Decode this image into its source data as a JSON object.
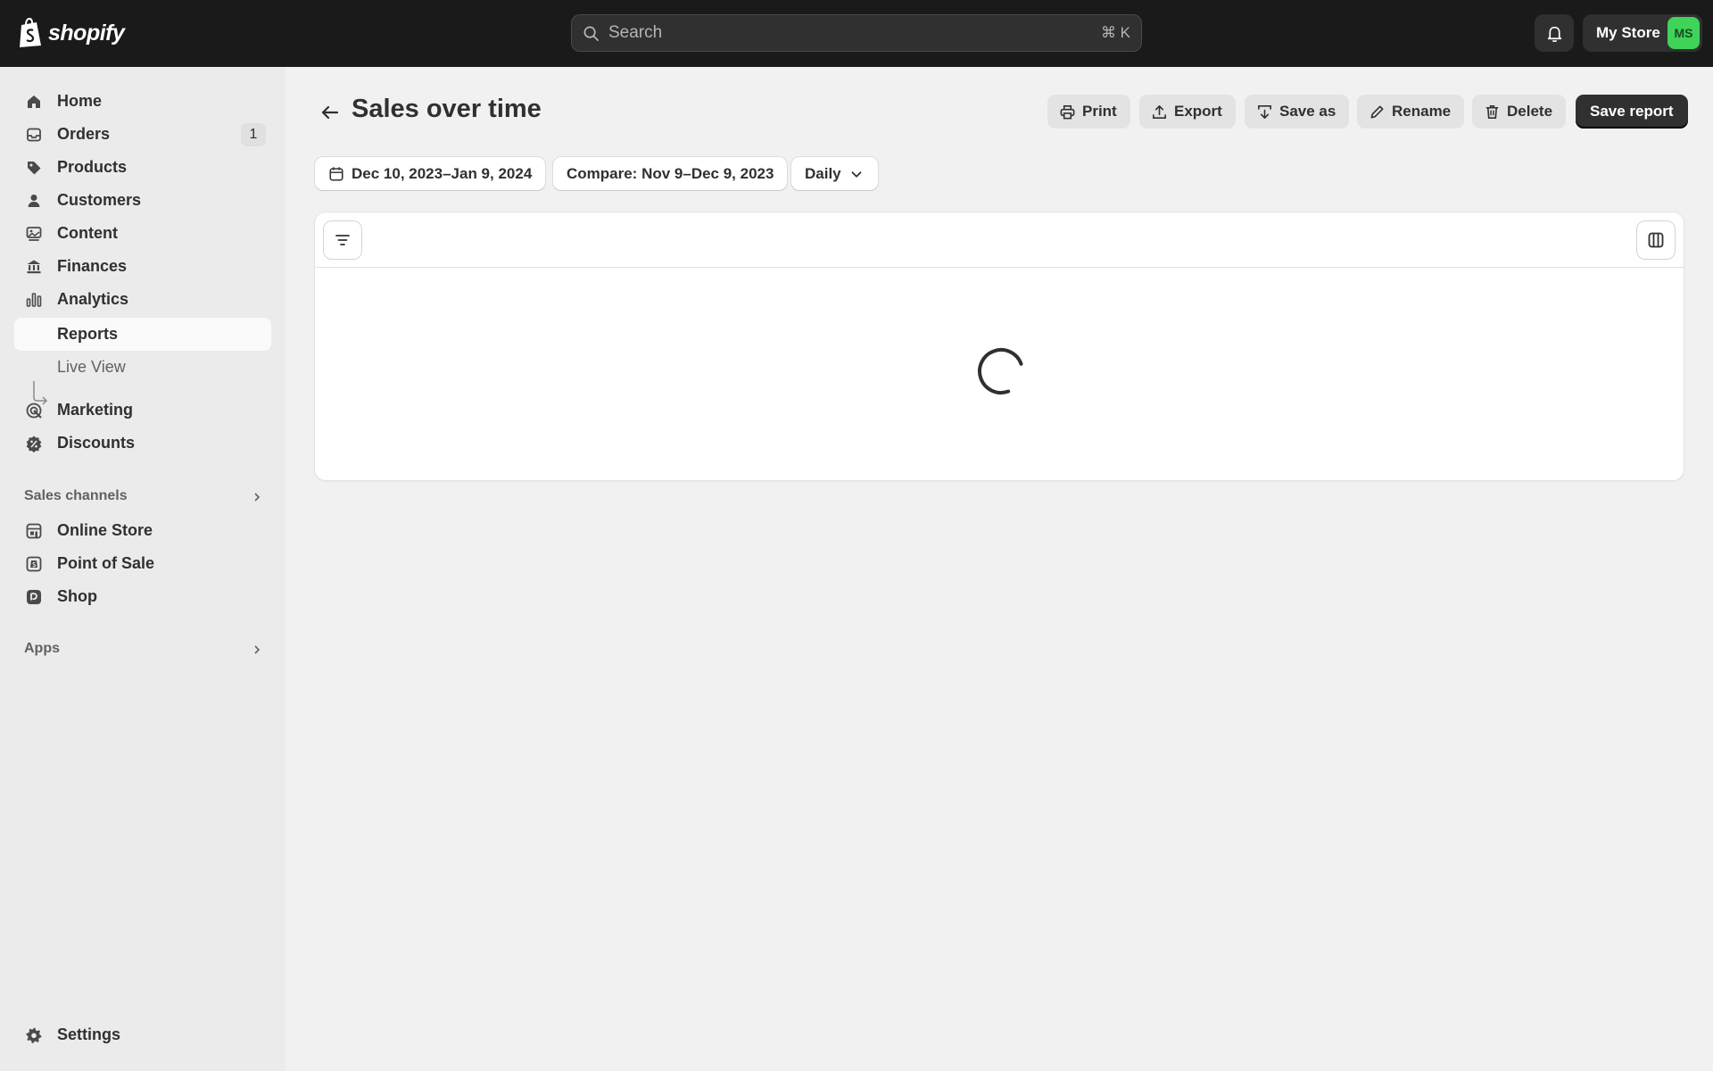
{
  "topbar": {
    "brand": "shopify",
    "search_placeholder": "Search",
    "search_shortcut": "⌘ K",
    "store_name": "My Store",
    "avatar_initials": "MS"
  },
  "sidebar": {
    "items": [
      {
        "label": "Home",
        "icon": "home-icon"
      },
      {
        "label": "Orders",
        "icon": "orders-icon",
        "badge": "1"
      },
      {
        "label": "Products",
        "icon": "tag-icon"
      },
      {
        "label": "Customers",
        "icon": "person-icon"
      },
      {
        "label": "Content",
        "icon": "content-icon"
      },
      {
        "label": "Finances",
        "icon": "bank-icon"
      },
      {
        "label": "Analytics",
        "icon": "bar-chart-icon"
      }
    ],
    "analytics_sub": [
      {
        "label": "Reports",
        "active": true
      },
      {
        "label": "Live View"
      }
    ],
    "marketing": [
      {
        "label": "Marketing",
        "icon": "target-icon"
      },
      {
        "label": "Discounts",
        "icon": "discount-icon"
      }
    ],
    "sales_channels_heading": "Sales channels",
    "sales_channels": [
      {
        "label": "Online Store",
        "icon": "store-icon"
      },
      {
        "label": "Point of Sale",
        "icon": "pos-icon"
      },
      {
        "label": "Shop",
        "icon": "shop-icon"
      }
    ],
    "apps_heading": "Apps",
    "settings_label": "Settings"
  },
  "page": {
    "title": "Sales over time",
    "actions": {
      "print": "Print",
      "export": "Export",
      "save_as": "Save as",
      "rename": "Rename",
      "delete": "Delete",
      "save_report": "Save report"
    },
    "filters": {
      "date_range": "Dec 10, 2023–Jan 9, 2024",
      "compare": "Compare: Nov 9–Dec 9, 2023",
      "granularity": "Daily"
    }
  },
  "colors": {
    "topbar": "#1a1a1a",
    "sidebar": "#ebebeb",
    "background": "#f1f1f1",
    "primary_button": "#303030",
    "avatar": "#3fd35a"
  }
}
